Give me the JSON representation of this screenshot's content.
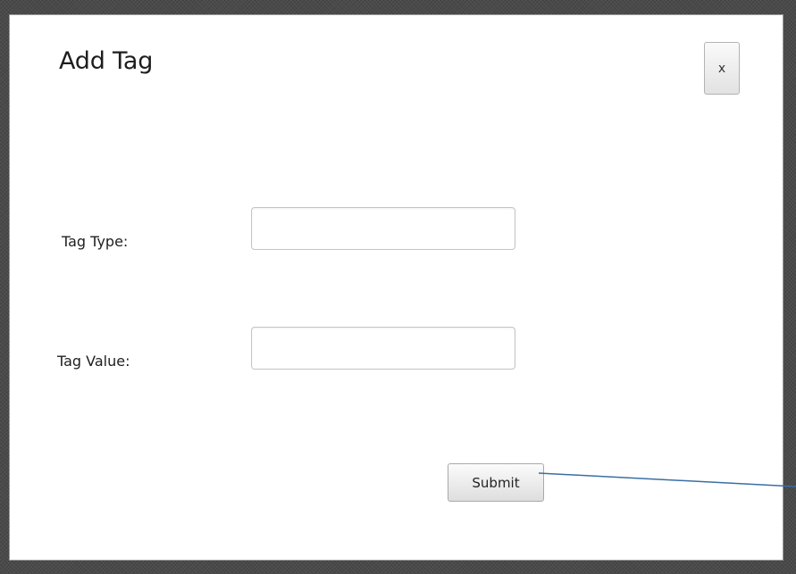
{
  "dialog": {
    "title": "Add Tag",
    "close_label": "x"
  },
  "form": {
    "tag_type": {
      "label": "Tag Type:",
      "value": "",
      "placeholder": ""
    },
    "tag_value": {
      "label": "Tag Value:",
      "value": "",
      "placeholder": ""
    },
    "submit_label": "Submit"
  },
  "colors": {
    "annotation_line": "#3a6ea5",
    "backdrop": "#4a4a4a",
    "dialog_background": "#ffffff"
  }
}
